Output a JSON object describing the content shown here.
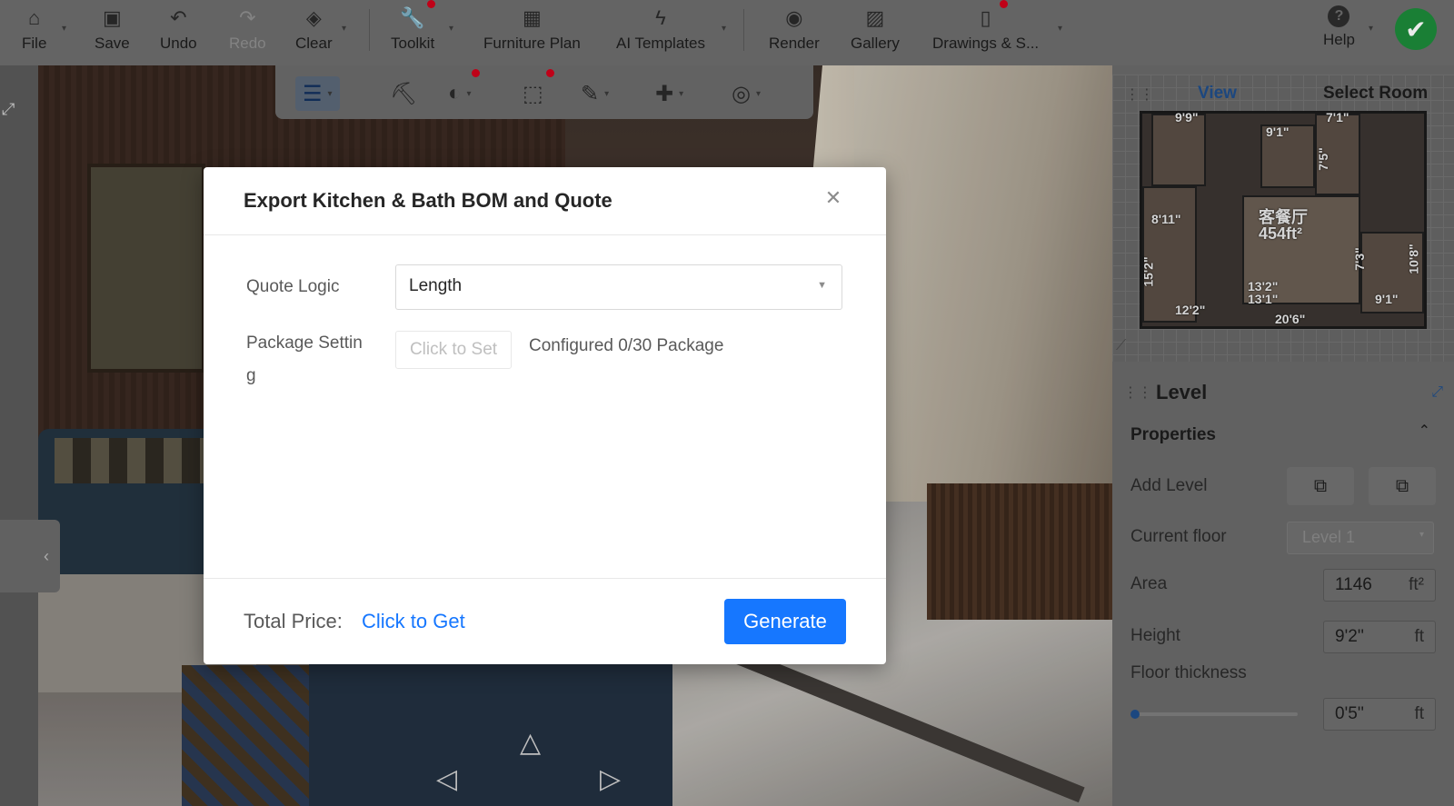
{
  "toolbar": {
    "file": "File",
    "save": "Save",
    "undo": "Undo",
    "redo": "Redo",
    "clear": "Clear",
    "toolkit": "Toolkit",
    "furniture_plan": "Furniture Plan",
    "ai_templates": "AI Templates",
    "render": "Render",
    "gallery": "Gallery",
    "drawings": "Drawings & S...",
    "help": "Help",
    "help_icon": "?",
    "confirm_icon": "✔"
  },
  "minimap": {
    "tab_view": "View",
    "tab_select_room": "Select Room",
    "dims": [
      "9'9\"",
      "9'1\"",
      "7'1\"",
      "7'5\"",
      "8'11\"",
      "15'2\"",
      "12'2\"",
      "13'2\"",
      "13'1\"",
      "7'3\"",
      "10'8\"",
      "9'1\"",
      "20'6\""
    ],
    "room_name": "客餐厅",
    "room_area": "454ft²"
  },
  "panel": {
    "level_title": "Level",
    "properties_title": "Properties",
    "add_level_label": "Add Level",
    "current_floor_label": "Current floor",
    "current_floor_value": "Level 1",
    "area_label": "Area",
    "area_value": "1146",
    "area_unit": "ft²",
    "height_label": "Height",
    "height_value": "9'2''",
    "height_unit": "ft",
    "floor_thickness_label": "Floor thickness",
    "floor_thickness_value": "0'5''",
    "floor_thickness_unit": "ft"
  },
  "modal": {
    "title": "Export Kitchen & Bath BOM and Quote",
    "quote_logic_label": "Quote Logic",
    "quote_logic_value": "Length",
    "package_setting_label_line1": "Package Settin",
    "package_setting_label_line2": "g",
    "click_to_set": "Click to Set",
    "configured_text": "Configured 0/30 Package",
    "total_price_label": "Total Price:",
    "click_to_get": "Click to Get",
    "generate": "Generate"
  },
  "colors": {
    "primary": "#1677ff",
    "confirm_green": "#1d8a3a",
    "notification_red": "#d0021b"
  }
}
